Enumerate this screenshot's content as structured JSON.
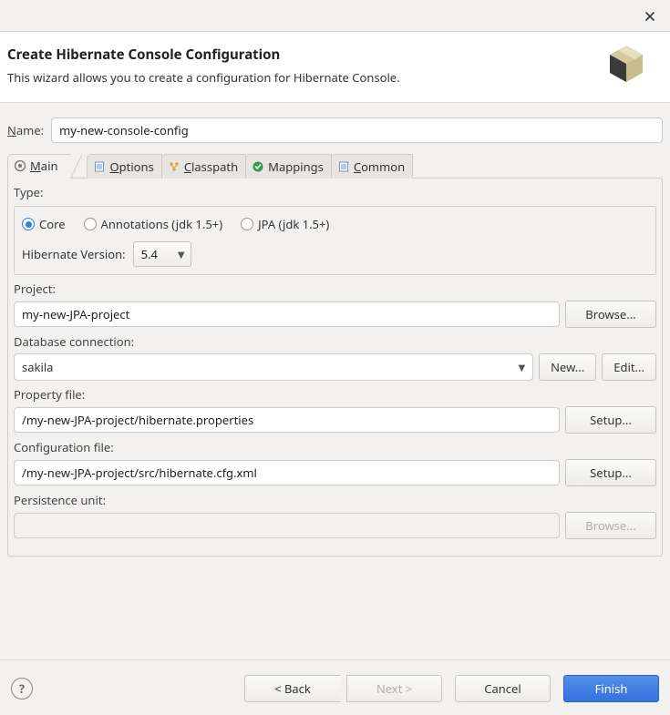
{
  "window": {
    "close_label": "×"
  },
  "banner": {
    "title": "Create Hibernate Console Configuration",
    "subtitle": "This wizard allows you to create a configuration for Hibernate Console."
  },
  "name": {
    "label_pre": "N",
    "label_rest": "ame:",
    "value": "my-new-console-config"
  },
  "tabs": [
    {
      "label_pre": "M",
      "label_rest": "ain",
      "icon": "hibernate"
    },
    {
      "label_pre": "O",
      "label_rest": "ptions",
      "icon": "sheet"
    },
    {
      "label_pre": "C",
      "label_rest": "lasspath",
      "icon": "tree"
    },
    {
      "label_pre": "",
      "label_rest": "Mappings",
      "icon": "mapped"
    },
    {
      "label_pre": "C",
      "label_rest": "ommon",
      "icon": "sheet"
    }
  ],
  "main": {
    "type": {
      "label": "Type:",
      "options": [
        {
          "label": "Core",
          "checked": true
        },
        {
          "label": "Annotations (jdk 1.5+)",
          "checked": false
        },
        {
          "label": "JPA (jdk 1.5+)",
          "checked": false
        }
      ],
      "hibernate_version_label": "Hibernate Version:",
      "hibernate_version_value": "5.4"
    },
    "project": {
      "label": "Project:",
      "value": "my-new-JPA-project",
      "browse": "Browse..."
    },
    "db": {
      "label": "Database connection:",
      "value": "sakila",
      "new": "New...",
      "edit": "Edit..."
    },
    "prop": {
      "label": "Property file:",
      "value": "/my-new-JPA-project/hibernate.properties",
      "setup": "Setup..."
    },
    "cfg": {
      "label": "Configuration file:",
      "value": "/my-new-JPA-project/src/hibernate.cfg.xml",
      "setup": "Setup..."
    },
    "pu": {
      "label": "Persistence unit:",
      "value": "",
      "browse": "Browse..."
    }
  },
  "buttons": {
    "back": "< Back",
    "next": "Next >",
    "cancel": "Cancel",
    "finish": "Finish",
    "help": "?"
  }
}
